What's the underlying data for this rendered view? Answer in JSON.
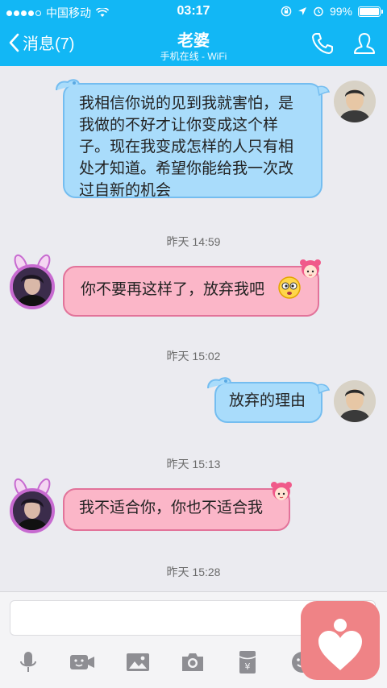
{
  "status": {
    "carrier": "中国移动",
    "time": "03:17",
    "battery": "99%",
    "battery_level": 0.99
  },
  "nav": {
    "back_label": "消息(7)",
    "title": "老婆",
    "subtitle": "手机在线 - WiFi"
  },
  "messages": [
    {
      "id": "m1",
      "direction": "outgoing",
      "text": "我相信你说的见到我就害怕，是我做的不好才让你变成这个样子。现在我变成怎样的人只有相处才知道。希望你能给我一次改过自新的机会"
    },
    {
      "id": "t1",
      "timestamp": "昨天 14:59"
    },
    {
      "id": "m2",
      "direction": "incoming",
      "text": "你不要再这样了，放弃我吧"
    },
    {
      "id": "t2",
      "timestamp": "昨天 15:02"
    },
    {
      "id": "m3",
      "direction": "outgoing",
      "text": "放弃的理由"
    },
    {
      "id": "t3",
      "timestamp": "昨天 15:13"
    },
    {
      "id": "m4",
      "direction": "incoming",
      "text": "我不适合你，你也不适合我"
    },
    {
      "id": "t4",
      "timestamp": "昨天 15:28"
    }
  ],
  "colors": {
    "header": "#12b7f5",
    "bubble_out": "#a9dcfb",
    "bubble_in": "#fbb6c8",
    "fab": "#ef8386"
  },
  "toolbar_icons": [
    "microphone-icon",
    "video-icon",
    "image-icon",
    "camera-icon",
    "red-packet-icon",
    "emoji-icon"
  ]
}
